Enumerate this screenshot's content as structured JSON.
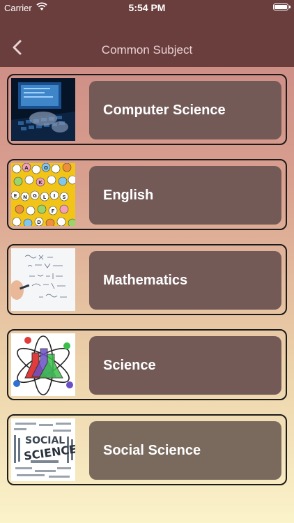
{
  "status": {
    "carrier": "Carrier",
    "time": "5:54 PM"
  },
  "nav": {
    "title": "Common Subject",
    "back_icon": "chevron-left-icon"
  },
  "subjects": [
    {
      "label": "Computer Science",
      "image": "computer-keyboard-image"
    },
    {
      "label": "English",
      "image": "letter-beads-image"
    },
    {
      "label": "Mathematics",
      "image": "whiteboard-equations-image"
    },
    {
      "label": "Science",
      "image": "atom-flasks-image"
    },
    {
      "label": "Social Science",
      "image": "word-cloud-image"
    }
  ],
  "colors": {
    "nav_background": "#6b3e3e",
    "card_fill": "#735a57",
    "gradient_top": "#c98582",
    "gradient_bottom": "#fbf3ca"
  }
}
